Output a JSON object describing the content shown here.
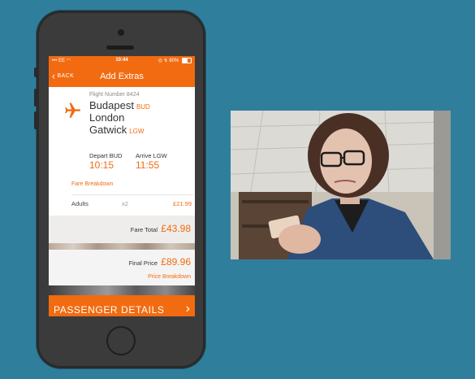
{
  "colors": {
    "accent": "#f26b11",
    "background": "#2f7f9c"
  },
  "status_bar": {
    "carrier": "••• EE ◠",
    "time": "10:44",
    "right": "◎ ↯ 80%"
  },
  "nav": {
    "back_label": "BACK",
    "back_icon": "chevron-left-icon",
    "title": "Add Extras"
  },
  "flight": {
    "number_label": "Flight Number 8424",
    "origin_city": "Budapest",
    "origin_code": "BUD",
    "dest_city_line1": "London",
    "dest_city_line2": "Gatwick",
    "dest_code": "LGW",
    "depart_label": "Depart BUD",
    "depart_time": "10:15",
    "arrive_label": "Arrive LGW",
    "arrive_time": "11:55",
    "icon": "airplane-icon"
  },
  "fare": {
    "breakdown_link": "Fare Breakdown",
    "adults_label": "Adults",
    "adults_count": "x2",
    "adults_price": "£21.99",
    "total_label": "Fare Total",
    "total_value": "£43.98"
  },
  "final": {
    "label": "Final Price",
    "value": "£89.96",
    "breakdown_link": "Price Breakdown"
  },
  "cta": {
    "label": "PASSENGER DETAILS",
    "icon": "chevron-right-icon"
  }
}
